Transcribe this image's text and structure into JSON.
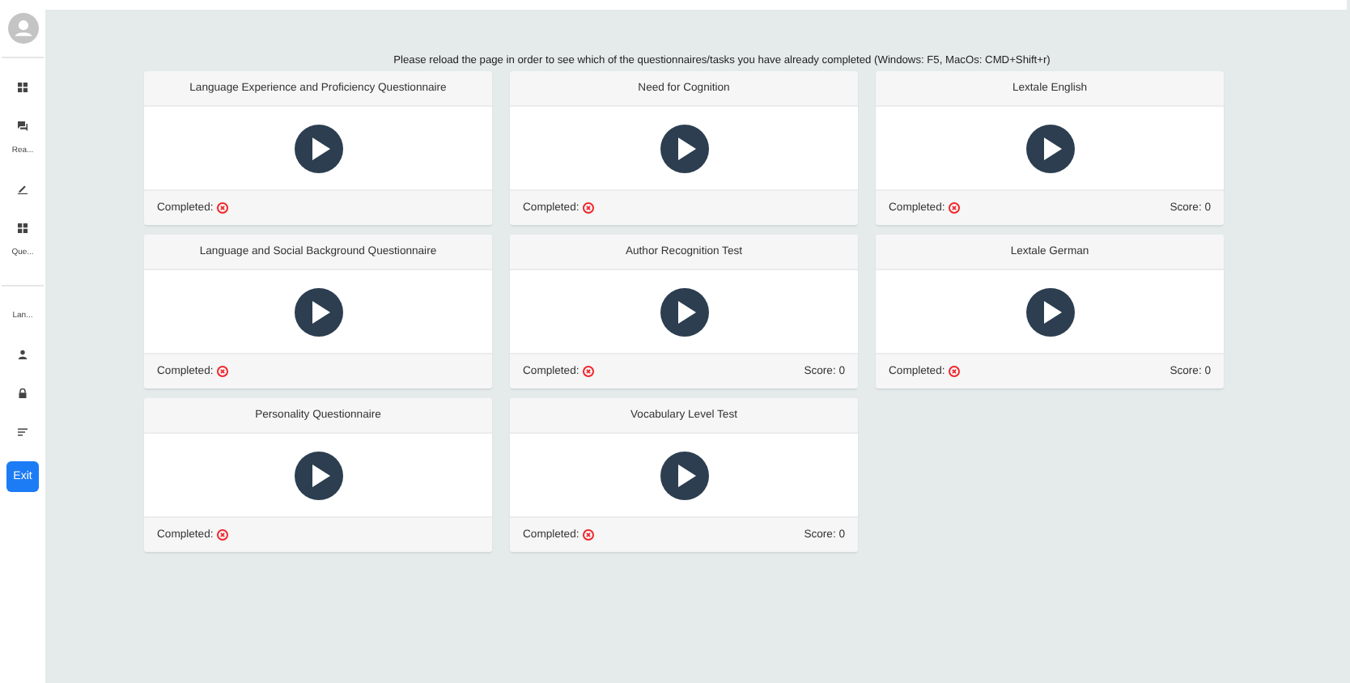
{
  "sidebar": {
    "items": [
      {
        "kind": "grid"
      },
      {
        "kind": "chat",
        "label": "Rea..."
      },
      {
        "kind": "pencil"
      },
      {
        "kind": "grid",
        "label": "Que..."
      },
      {
        "kind": "divider"
      },
      {
        "kind": "text",
        "label": "Lan..."
      },
      {
        "kind": "person"
      },
      {
        "kind": "lock"
      },
      {
        "kind": "filter"
      }
    ],
    "exit": "Exit"
  },
  "notice": "Please reload the page in order to see which of the questionnaires/tasks you have already completed (Windows: F5, MacOs: CMD+Shift+r)",
  "cards": [
    {
      "title": "Language Experience and Proficiency Questionnaire",
      "completed_label": "Completed:",
      "completed": false
    },
    {
      "title": "Need for Cognition",
      "completed_label": "Completed:",
      "completed": false
    },
    {
      "title": "Lextale English",
      "completed_label": "Completed:",
      "completed": false,
      "score": "Score: 0"
    },
    {
      "title": "Language and Social Background Questionnaire",
      "completed_label": "Completed:",
      "completed": false
    },
    {
      "title": "Author Recognition Test",
      "completed_label": "Completed:",
      "completed": false,
      "score": "Score: 0"
    },
    {
      "title": "Lextale German",
      "completed_label": "Completed:",
      "completed": false,
      "score": "Score: 0"
    },
    {
      "title": "Personality Questionnaire",
      "completed_label": "Completed:",
      "completed": false
    },
    {
      "title": "Vocabulary Level Test",
      "completed_label": "Completed:",
      "completed": false,
      "score": "Score: 0"
    }
  ]
}
